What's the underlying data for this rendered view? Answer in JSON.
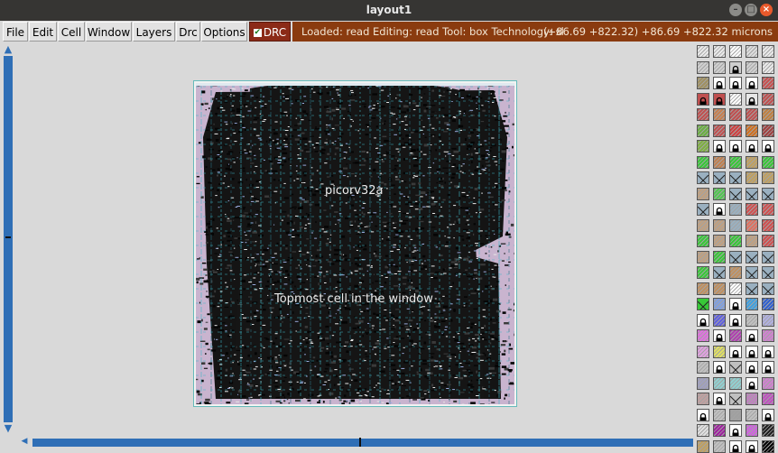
{
  "window": {
    "title": "layout1",
    "controls": [
      "–",
      "□",
      "×"
    ]
  },
  "menu": {
    "file": "File",
    "edit": "Edit",
    "cell": "Cell",
    "window": "Window",
    "layers": "Layers",
    "drc": "Drc",
    "options": "Options",
    "drc_toggle": "DRC"
  },
  "status": {
    "message": "Loaded: read Editing: read Tool: box  Technology: sky",
    "coords": "(+86.69 +822.32) +86.69 +822.32 microns"
  },
  "layout": {
    "cell_name": "picorv32a",
    "topmost_label": "Topmost cell in the window"
  },
  "colors": {
    "accent_blue": "#2f6fb6",
    "status_brown": "#8a3b0f",
    "drc_red": "#8b2a17",
    "cell_lavender": "#c9b4cf"
  },
  "palette_icons": [
    "layer-swatch",
    "lock-icon",
    "cross-hatch"
  ]
}
